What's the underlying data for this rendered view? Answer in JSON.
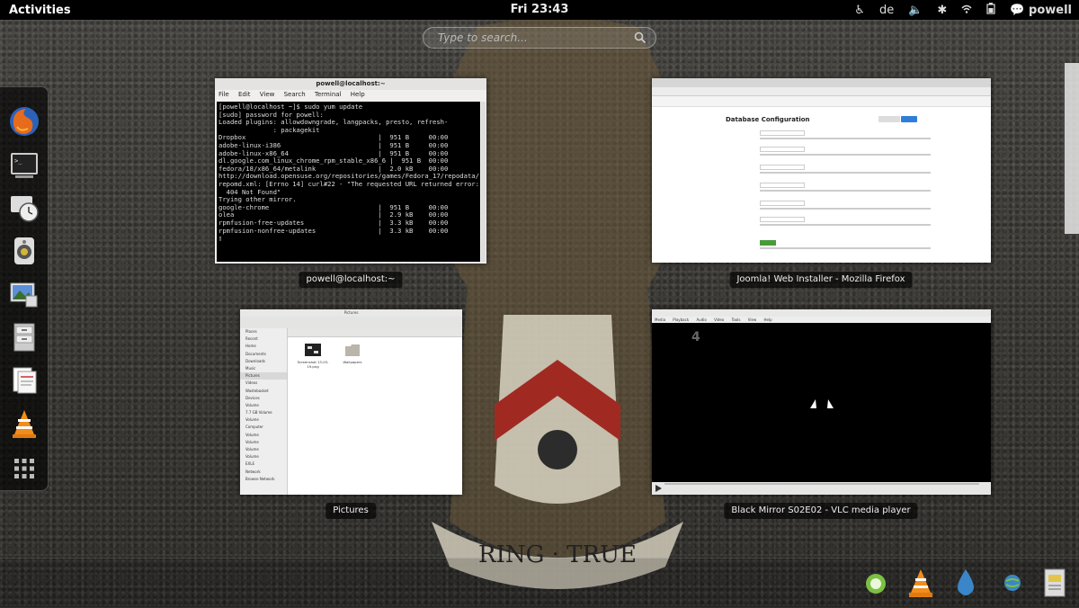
{
  "topbar": {
    "activities": "Activities",
    "clock": "Fri 23:43",
    "keyboard_layout": "de",
    "user": "powell"
  },
  "search": {
    "placeholder": "Type to search..."
  },
  "dash": {
    "items": [
      "firefox-icon",
      "terminal-icon",
      "clock-icon",
      "speaker-icon",
      "image-viewer-icon",
      "file-cabinet-icon",
      "text-editor-icon",
      "vlc-icon",
      "show-applications-icon"
    ]
  },
  "windows": [
    {
      "label": "powell@localhost:~",
      "title": "powell@localhost:~",
      "menu": [
        "File",
        "Edit",
        "View",
        "Search",
        "Terminal",
        "Help"
      ],
      "lines": [
        "[powell@localhost ~]$ sudo yum update",
        "[sudo] password for powell:",
        "Loaded plugins: allowdowngrade, langpacks, presto, refresh-",
        "              : packagekit",
        "Dropbox                                  |  951 B     00:00",
        "adobe-linux-i386                         |  951 B     00:00",
        "adobe-linux-x86_64                       |  951 B     00:00",
        "dl.google.com_linux_chrome_rpm_stable_x86_6 |  951 B  00:00",
        "fedora/18/x86_64/metalink                |  2.0 kB    00:00",
        "http://download.opensuse.org/repositories/games/Fedora_17/repodata/",
        "repomd.xml: [Errno 14] curl#22 - \"The requested URL returned error:",
        "  404 Not Found\"",
        "Trying other mirror.",
        "google-chrome                            |  951 B     00:00",
        "olea                                     |  2.9 kB    00:00",
        "rpmfusion-free-updates                   |  3.3 kB    00:00",
        "rpmfusion-nonfree-updates                |  3.3 kB    00:00"
      ]
    },
    {
      "label": "Joomla! Web Installer - Mozilla Firefox",
      "heading": "Database Configuration"
    },
    {
      "label": "Pictures",
      "title": "Pictures",
      "sidebar": [
        "Places",
        "Recent",
        "Home",
        "Documents",
        "Downloads",
        "Music",
        "Pictures",
        "Videos",
        "Wastebasket",
        "Devices",
        "Volume",
        "7.7 GB Volume",
        "Volume",
        "Computer",
        "Volume",
        "Volume",
        "Volume",
        "Volume",
        "EXLE",
        "Network",
        "Browse Network"
      ],
      "files": [
        "Screenshot 13-03-19.png",
        "Wallpapers"
      ]
    },
    {
      "label": "Black Mirror S02E02 - VLC media player",
      "menu": [
        "Media",
        "Playback",
        "Audio",
        "Video",
        "Tools",
        "View",
        "Help"
      ]
    }
  ],
  "bottom_tray": [
    "pidgin-icon",
    "vlc-tray-icon",
    "dropbox-drop-icon",
    "network-globe-icon",
    "notes-icon"
  ]
}
